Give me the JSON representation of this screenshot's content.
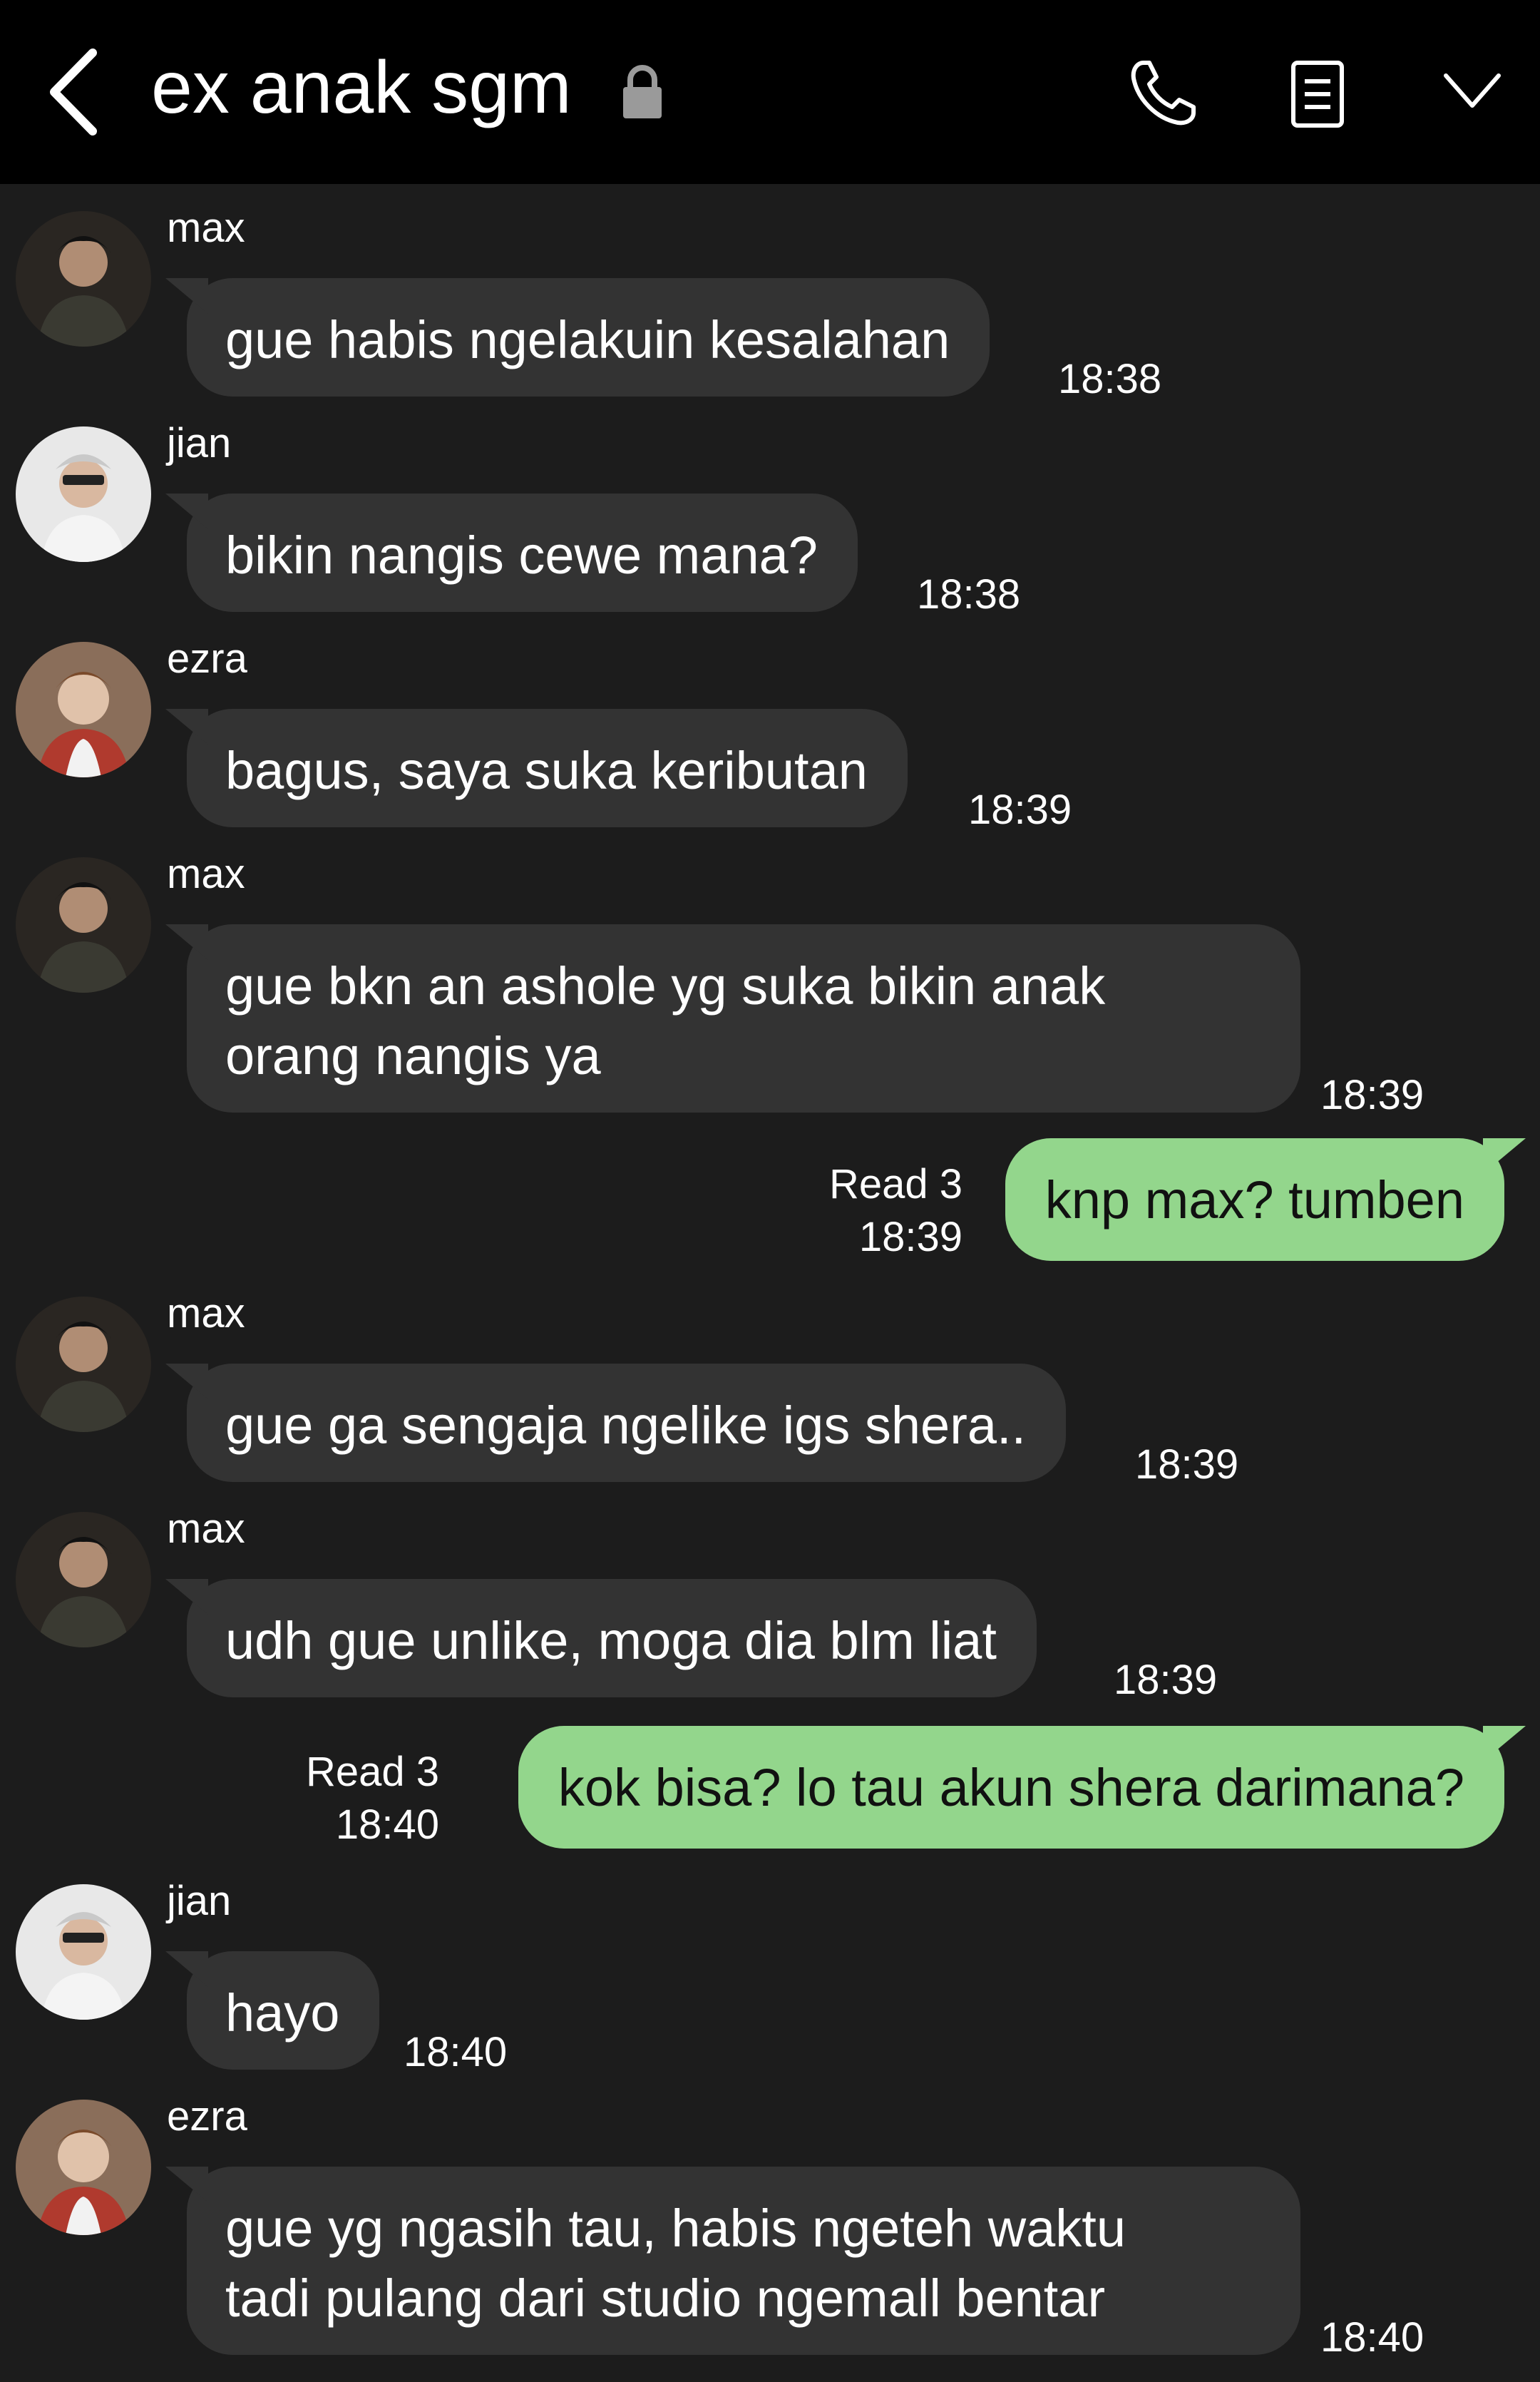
{
  "header": {
    "title": "ex anak sgm",
    "icons": [
      "back-arrow-icon",
      "lock-icon",
      "phone-icon",
      "notes-icon",
      "chevron-down-icon"
    ]
  },
  "colors": {
    "header_bg": "#000000",
    "chat_bg": "#1c1c1c",
    "incoming_bubble": "#333333",
    "outgoing_bubble": "#93d68c"
  },
  "messages": [
    {
      "sender": "max",
      "text": "gue habis ngelakuin kesalahan",
      "time": "18:38"
    },
    {
      "sender": "jian",
      "text": "bikin nangis cewe mana?",
      "time": "18:38"
    },
    {
      "sender": "ezra",
      "text": "bagus, saya suka keributan",
      "time": "18:39"
    },
    {
      "sender": "max",
      "line1": "gue bkn an ashole yg suka bikin anak",
      "line2": "orang nangis ya",
      "time": "18:39"
    },
    {
      "outgoing": true,
      "text": "knp max? tumben",
      "read": "Read 3",
      "time": "18:39"
    },
    {
      "sender": "max",
      "text": "gue ga sengaja ngelike igs shera..",
      "time": "18:39"
    },
    {
      "sender": "max",
      "text": "udh gue unlike, moga dia blm liat",
      "time": "18:39"
    },
    {
      "outgoing": true,
      "text": "kok bisa? lo tau akun shera darimana?",
      "read": "Read 3",
      "time": "18:40"
    },
    {
      "sender": "jian",
      "text": "hayo",
      "time": "18:40"
    },
    {
      "sender": "ezra",
      "line1": "gue yg ngasih tau, habis ngeteh waktu",
      "line2": "tadi pulang dari studio ngemall bentar",
      "time": "18:40"
    }
  ]
}
